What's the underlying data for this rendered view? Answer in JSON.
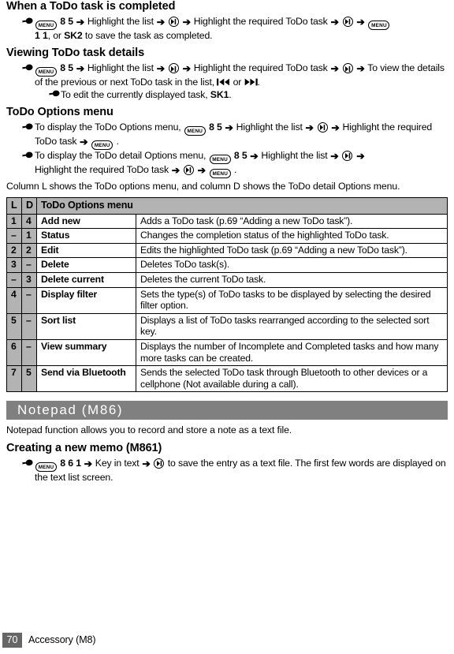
{
  "sections": {
    "completed": {
      "heading": "When a ToDo task is completed",
      "step_pre": "",
      "t1": "8 5",
      "t2": "Highlight the list",
      "t3": "Highlight the required ToDo task",
      "t4": "1 1",
      "t5": ", or ",
      "t6": "SK2",
      "t7": " to save the task as completed."
    },
    "viewing": {
      "heading": "Viewing ToDo task details",
      "t1": "8 5",
      "t2": "Highlight the list",
      "t3": "Highlight the required ToDo task",
      "t4": "To view the details of the previous or next ToDo task in the list,",
      "t5": "or",
      "t6": ".",
      "sub1_pre": "To edit the currently displayed task, ",
      "sub1_key": "SK1",
      "sub1_post": "."
    },
    "options": {
      "heading": "ToDo Options menu",
      "b1_pre": "To display the ToDo Options menu,",
      "b1_t1": "8 5",
      "b1_t2": "Highlight the list",
      "b1_t3": "Highlight the required ToDo task",
      "b1_end": ".",
      "b2_pre": "To display the ToDo detail Options menu,",
      "b2_t1": "8 5",
      "b2_t2": "Highlight the list",
      "b2_t3": "Highlight the required ToDo task",
      "b2_end": ".",
      "note": "Column L shows the ToDo options menu, and column D shows the ToDo detail Options menu."
    },
    "notepad": {
      "bar_title": "Notepad (M86)",
      "intro": "Notepad function allows you to record and store a note as a text file.",
      "heading": "Creating a new memo (M861)",
      "t1": "8 6 1",
      "t2": "Key in text",
      "t3": "to save the entry as a text file. The first few words are displayed on the text list screen."
    }
  },
  "table": {
    "headers": [
      "L",
      "D",
      "ToDo Options menu"
    ],
    "rows": [
      {
        "l": "1",
        "d": "4",
        "name": "Add new",
        "desc": "Adds a ToDo task (p.69 “Adding a new ToDo task”)."
      },
      {
        "l": "–",
        "d": "1",
        "name": "Status",
        "desc": "Changes the completion status of the highlighted ToDo task."
      },
      {
        "l": "2",
        "d": "2",
        "name": "Edit",
        "desc": "Edits the highlighted ToDo task (p.69 “Adding a new ToDo task”)."
      },
      {
        "l": "3",
        "d": "–",
        "name": "Delete",
        "desc": "Deletes ToDo task(s)."
      },
      {
        "l": "–",
        "d": "3",
        "name": "Delete current",
        "desc": "Deletes the current ToDo task."
      },
      {
        "l": "4",
        "d": "–",
        "name": "Display filter",
        "desc": "Sets the type(s) of ToDo tasks to be displayed by selecting the desired filter option."
      },
      {
        "l": "5",
        "d": "–",
        "name": "Sort list",
        "desc": "Displays a list of ToDo tasks rearranged according to the selected sort key."
      },
      {
        "l": "6",
        "d": "–",
        "name": "View summary",
        "desc": "Displays the number of Incomplete and Completed tasks and how many more tasks can be created."
      },
      {
        "l": "7",
        "d": "5",
        "name": "Send via Bluetooth",
        "desc": "Sends the selected ToDo task through Bluetooth to other devices or a cellphone (Not available during a call)."
      }
    ]
  },
  "keys": {
    "menu_label": "MENU",
    "arrow": "➔"
  },
  "footer": {
    "page_number": "70",
    "title": "Accessory (M8)"
  },
  "colors": {
    "table_header_gray": "#b3b3b3",
    "section_bar_gray": "#808080",
    "page_number_gray": "#666666"
  }
}
